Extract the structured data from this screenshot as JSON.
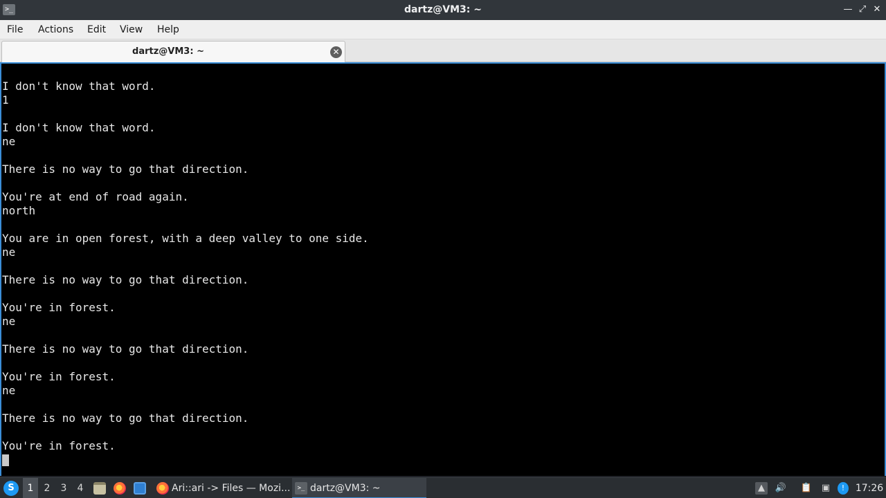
{
  "window": {
    "title": "dartz@VM3: ~",
    "app_icon": "terminal-icon",
    "minimize_icon": "minimize-icon",
    "maximize_icon": "maximize-icon",
    "close_icon": "close-icon"
  },
  "menu": {
    "items": [
      {
        "label": "File"
      },
      {
        "label": "Actions"
      },
      {
        "label": "Edit"
      },
      {
        "label": "View"
      },
      {
        "label": "Help"
      }
    ]
  },
  "tabs": [
    {
      "label": "dartz@VM3: ~",
      "active": true
    }
  ],
  "terminal": {
    "lines": [
      "",
      "I don't know that word.",
      "1",
      "",
      "I don't know that word.",
      "ne",
      "",
      "There is no way to go that direction.",
      "",
      "You're at end of road again.",
      "north",
      "",
      "You are in open forest, with a deep valley to one side.",
      "ne",
      "",
      "There is no way to go that direction.",
      "",
      "You're in forest.",
      "ne",
      "",
      "There is no way to go that direction.",
      "",
      "You're in forest.",
      "ne",
      "",
      "There is no way to go that direction.",
      "",
      "You're in forest."
    ],
    "colors": {
      "background": "#000000",
      "foreground": "#e8e8e8",
      "focus_border": "#3b8ed8"
    }
  },
  "taskbar": {
    "desktops": [
      "1",
      "2",
      "3",
      "4"
    ],
    "active_desktop": "1",
    "tasks": [
      {
        "label": "Ari::ari -> Files — Mozi...",
        "icon": "firefox-icon"
      },
      {
        "label": "dartz@VM3: ~",
        "icon": "terminal-icon",
        "active": true
      }
    ],
    "clock": "17:26"
  }
}
